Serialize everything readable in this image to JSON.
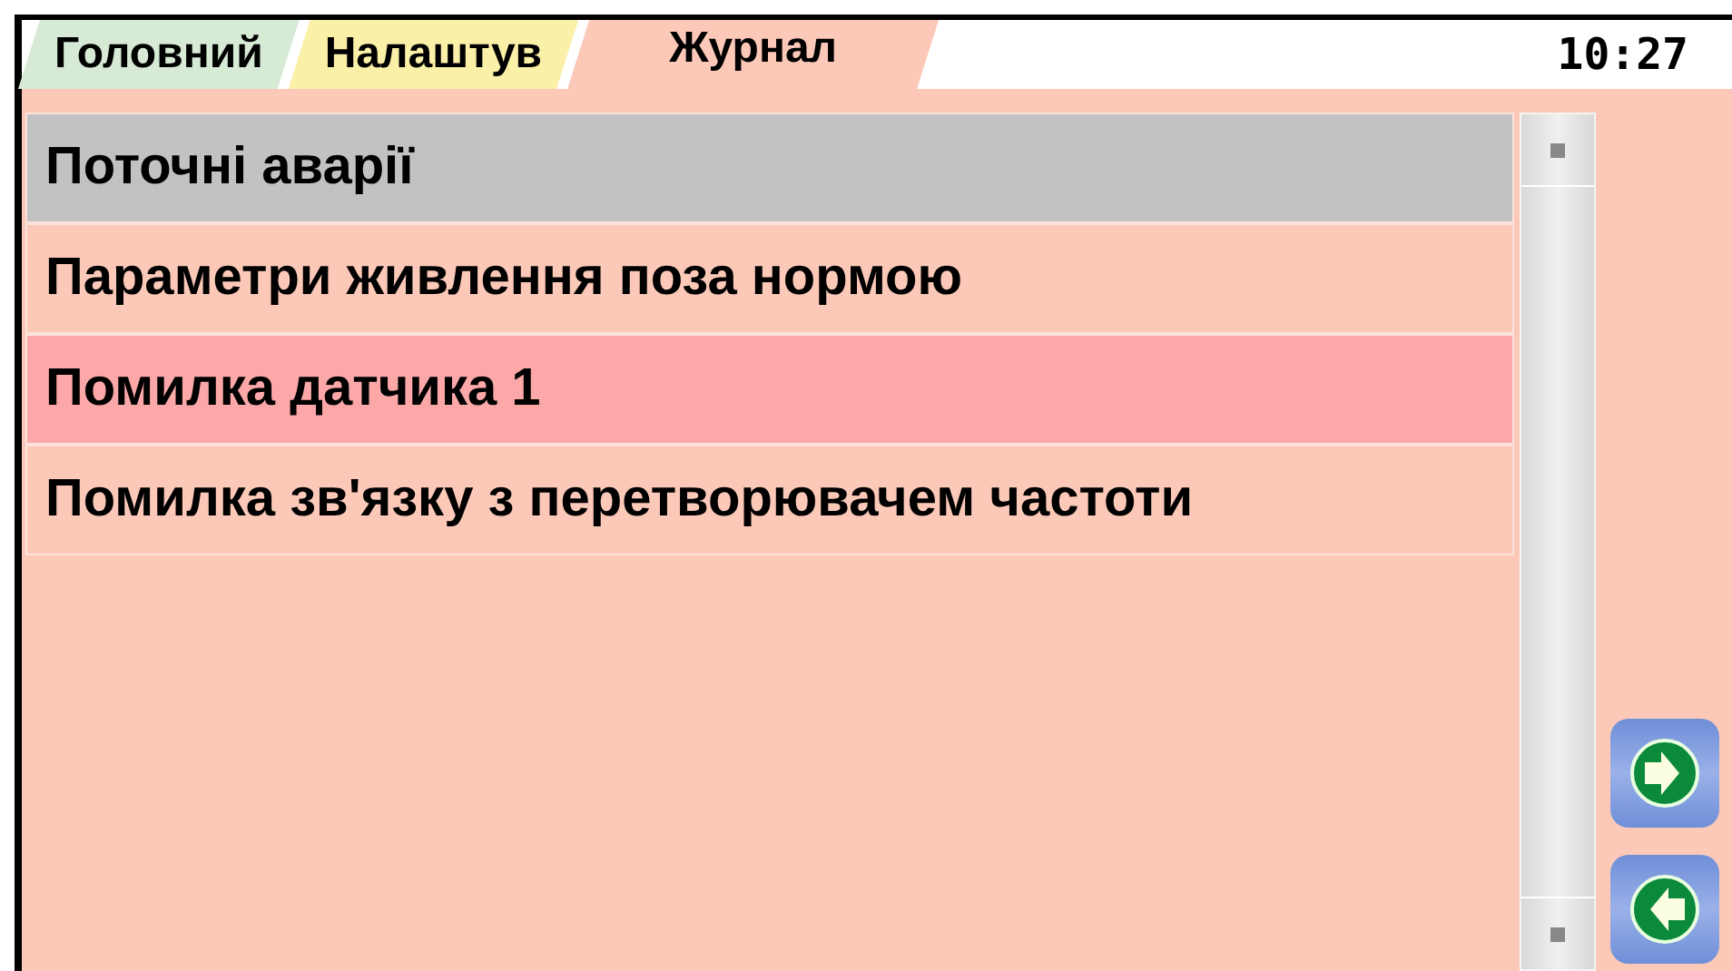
{
  "tabs": [
    {
      "label": "Головний",
      "selected": false,
      "color": "#d6ead6"
    },
    {
      "label": "Налаштув",
      "selected": false,
      "color": "#fbf0a8"
    },
    {
      "label": "Журнал",
      "selected": true,
      "color": "#fcc9b9"
    }
  ],
  "clock": "10:27",
  "list": {
    "rows": [
      {
        "kind": "header",
        "label": "Поточні аварії",
        "selected": false
      },
      {
        "kind": "item",
        "label": "Параметри живлення поза нормою",
        "selected": false
      },
      {
        "kind": "item",
        "label": "Помилка датчика 1",
        "selected": true
      },
      {
        "kind": "item",
        "label": "Помилка зв'язку з перетворювачем частоти",
        "selected": false
      }
    ]
  },
  "nav_buttons": [
    {
      "kind": "next"
    },
    {
      "kind": "back"
    }
  ]
}
